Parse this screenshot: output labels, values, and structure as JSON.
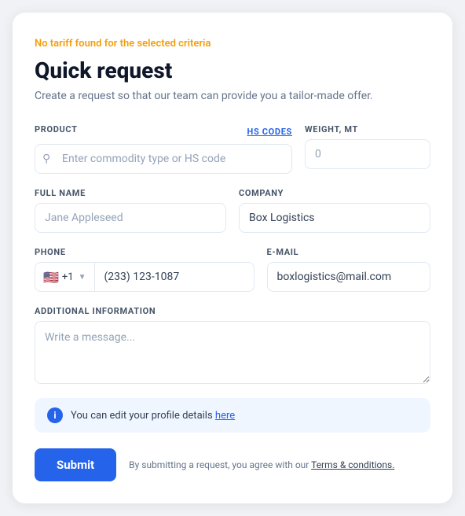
{
  "error": {
    "message": "No tariff found for the selected criteria"
  },
  "title": "Quick request",
  "subtitle": "Create a request so that our team can provide you a tailor-made offer.",
  "form": {
    "product_label": "PRODUCT",
    "hs_codes_label": "HS CODES",
    "product_placeholder": "Enter commodity type or HS code",
    "weight_label": "WEIGHT, MT",
    "weight_placeholder": "0",
    "fullname_label": "FULL NAME",
    "fullname_placeholder": "Jane Appleseed",
    "company_label": "COMPANY",
    "company_value": "Box Logistics",
    "phone_label": "PHONE",
    "phone_flag": "🇺🇸",
    "phone_dial": "+1",
    "phone_value": "(233) 123-1087",
    "email_label": "E-MAIL",
    "email_value": "boxlogistics@mail.com",
    "additional_label": "ADDITIONAL INFORMATION",
    "additional_placeholder": "Write a message..."
  },
  "info_banner": {
    "text": "You can edit your profile details ",
    "link_text": "here"
  },
  "footer": {
    "submit_label": "Submit",
    "terms_text": "By submitting a request, you agree with our ",
    "terms_link": "Terms & conditions."
  }
}
